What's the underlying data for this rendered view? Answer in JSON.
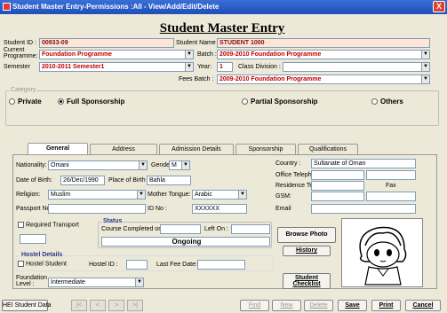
{
  "window": {
    "title": "Student Master Entry-Permissions :All - View/Add/Edit/Delete",
    "close": "X"
  },
  "header": {
    "title": "Student Master Entry"
  },
  "student": {
    "id_label": "Student ID :",
    "id_value": "00933-09",
    "name_label": "Student Name",
    "name_value": "STUDENT 1000",
    "current_programme_label": "Current\nProgramme:",
    "current_programme_value": "Foundation Programme",
    "batch_label": "Batch :",
    "batch_value": "2009-2010 Foundation Programme",
    "semester_label": "Semester",
    "semester_value": "2010-2011 Semester1",
    "year_label": "Year:",
    "year_value": "1",
    "class_division_label": "Class Division :",
    "class_division_value": "",
    "fees_batch_label": "Fees Batch :",
    "fees_batch_value": "2009-2010 Foundation Programme"
  },
  "category": {
    "label": "Category",
    "options": [
      "Private",
      "Full Sponsorship",
      "Partial Sponsorship",
      "Others"
    ],
    "selected": "Full Sponsorship"
  },
  "tabs": [
    "General",
    "Address",
    "Admission Details",
    "Sponsorship",
    "Qualifications"
  ],
  "general": {
    "nationality_label": "Nationality:",
    "nationality_value": "Omani",
    "gender_label": "Gender",
    "gender_value": "M",
    "country_label": "Country :",
    "country_value": "Sultanate of Oman",
    "office_tel_label": "Office Telephone",
    "office_tel_value": "",
    "dob_label": "Date of Birth:",
    "dob_value": "26/Dec/1990",
    "pob_label": "Place of Birth :",
    "pob_value": "Bahla",
    "residence_tel_label": "Residence Tel",
    "residence_tel_value": "",
    "fax_label": "Fax",
    "religion_label": "Religion:",
    "religion_value": "Muslim",
    "mother_tongue_label": "Mother Tongue:",
    "mother_tongue_value": "Arabic",
    "gsm_label": "GSM:",
    "gsm_value": "",
    "passport_label": "Passport No",
    "passport_value": "",
    "id_no_label": "ID No :",
    "id_no_value": "XXXXXX",
    "email_label": "Email",
    "email_value": "",
    "required_transport_label": "Required Transport",
    "status_label": "Status",
    "course_completed_label": "Course Completed on",
    "course_completed_value": "",
    "left_on_label": "Left  On :",
    "left_on_value": "",
    "status_value": "Ongoing",
    "browse_photo": "Browse Photo",
    "history": "History",
    "hostel_details_label": "Hostel Details",
    "hostel_student_label": "Hostel Student",
    "hostel_id_label": "Hostel ID :",
    "hostel_id_value": "",
    "last_fee_label": "Last Fee Date:",
    "last_fee_value": "",
    "foundation_level_label": "Foundation\nLevel :",
    "foundation_level_value": "Intermediate",
    "student_checklist": "Student\nChecklist"
  },
  "bottom": {
    "hei": "HEI Student Data",
    "nav": [
      "|<",
      "<",
      ">",
      ">|"
    ],
    "find": "Find",
    "new": "New",
    "delete": "Delete",
    "save": "Save",
    "print": "Print",
    "cancel": "Cancel"
  }
}
